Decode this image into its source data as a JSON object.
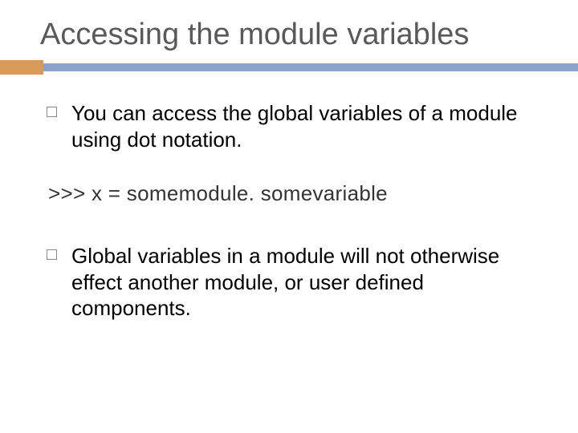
{
  "title": "Accessing the module variables",
  "bullets": [
    "You can access the global variables of a module using dot notation.",
    "Global variables in a module will not otherwise effect another module, or user defined components."
  ],
  "code": ">>> x = somemodule. somevariable"
}
